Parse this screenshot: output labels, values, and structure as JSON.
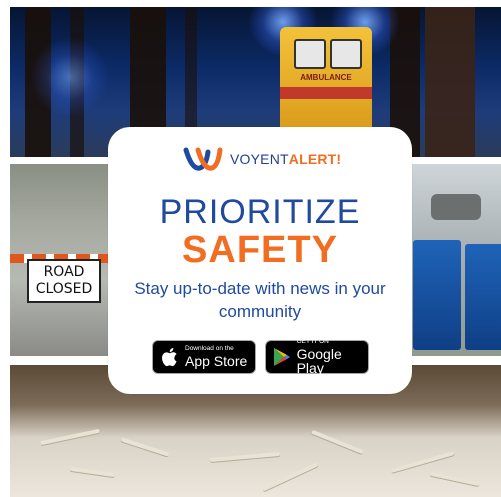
{
  "brand": {
    "name_primary": "VOYENT",
    "name_accent": "ALERT!"
  },
  "photos": {
    "ambulance": {
      "vehicle_label": "AMBULANCE"
    },
    "road": {
      "sign_line1": "ROAD",
      "sign_line2": "CLOSED"
    }
  },
  "card": {
    "headline_line1": "PRIORITIZE",
    "headline_line2": "SAFETY",
    "tagline": "Stay up-to-date with news in your community"
  },
  "badges": {
    "app_store": {
      "small": "Download on the",
      "big": "App Store",
      "icon": "apple-icon"
    },
    "google_play": {
      "small": "GET IT ON",
      "big": "Google Play",
      "icon": "play-icon"
    }
  },
  "colors": {
    "brand_blue": "#1f4aa0",
    "brand_orange": "#f26d21"
  }
}
